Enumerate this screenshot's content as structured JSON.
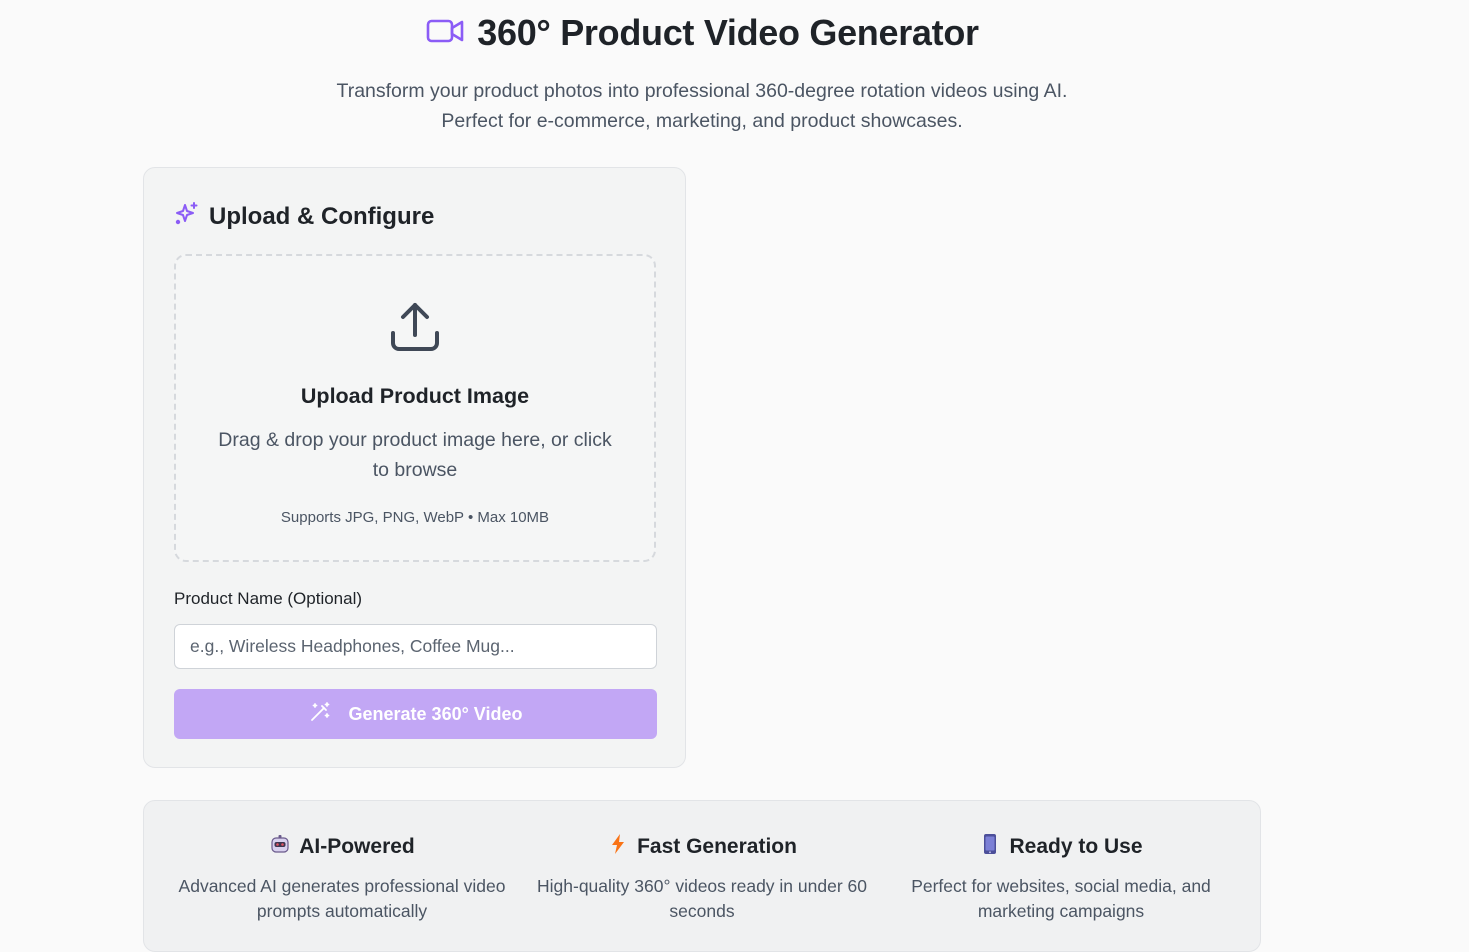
{
  "header": {
    "title": "360° Product Video Generator",
    "subtitle_line1": "Transform your product photos into professional 360-degree rotation videos using AI.",
    "subtitle_line2": "Perfect for e-commerce, marketing, and product showcases.",
    "icon": "video-camera-icon"
  },
  "config": {
    "title": "Upload & Configure",
    "icon": "sparkles-icon",
    "upload": {
      "icon": "upload-icon",
      "title": "Upload Product Image",
      "description": "Drag & drop your product image here, or click to browse",
      "note": "Supports JPG, PNG, WebP • Max 10MB"
    },
    "product_name": {
      "label": "Product Name (Optional)",
      "value": "",
      "placeholder": "e.g., Wireless Headphones, Coffee Mug..."
    },
    "generate_button": {
      "label": "Generate 360° Video",
      "icon": "magic-wand-icon",
      "disabled": true
    }
  },
  "features": [
    {
      "icon": "robot-icon",
      "title": "AI-Powered",
      "description": "Advanced AI generates professional video prompts automatically"
    },
    {
      "icon": "lightning-icon",
      "title": "Fast Generation",
      "description": "High-quality 360° videos ready in under 60 seconds"
    },
    {
      "icon": "mobile-phone-icon",
      "title": "Ready to Use",
      "description": "Perfect for websites, social media, and marketing campaigns"
    }
  ],
  "colors": {
    "accent": "#8b5cf6",
    "button_disabled": "#c2a7f5",
    "background": "#fafafa"
  }
}
